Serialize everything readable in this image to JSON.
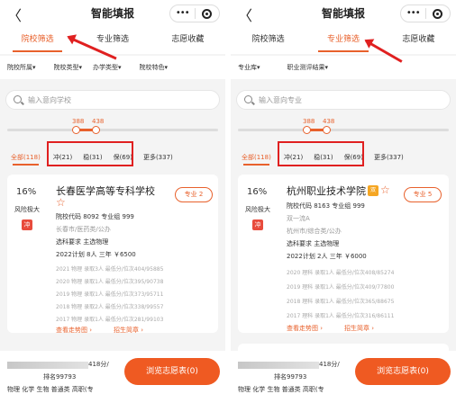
{
  "left": {
    "nav": {
      "title": "智能填报"
    },
    "tabs": [
      {
        "label": "院校筛选"
      },
      {
        "label": "专业筛选"
      },
      {
        "label": "志愿收藏"
      }
    ],
    "filters": [
      "院校所属▾",
      "院校类型▾",
      "办学类型▾",
      "院校特色▾"
    ],
    "search": {
      "placeholder": "输入意向学校"
    },
    "scores": {
      "low": "388",
      "high": "438"
    },
    "segments": {
      "all": "全部(118)",
      "chong": "冲(21)",
      "wen": "稳(31)",
      "bao": "保(69)",
      "more": "更多(337)"
    },
    "card": {
      "pct": "16%",
      "risk": "风险极大",
      "badge": "冲",
      "name": "长春医学高等专科学校",
      "major_btn": "专业 2",
      "code": "院校代码 8092  专业组 999",
      "location": "长春市/医药类/公办",
      "subject": "选科要求 主选物理",
      "plan": "2022计划 8人 三年 ￥6500",
      "history": [
        "2021 物理 录取3人 最低分/位次404/95885",
        "2020 物理 录取1人 最低分/位次395/90738",
        "2019 物理 录取1人 最低分/位次373/95711",
        "2018 物理 录取2人 最低分/位次338/99557",
        "2017 物理 录取1人 最低分/位次281/99103"
      ],
      "trend_link": "查看走势图 ›",
      "brochure_link": "招生简章 ›"
    },
    "bottom": {
      "rank_suffix": "418分/",
      "rank": "排名99793",
      "subjects": "物理 化学 生物 普通类 高职(专",
      "cta": "浏览志愿表(0)"
    }
  },
  "right": {
    "nav": {
      "title": "智能填报"
    },
    "tabs": [
      {
        "label": "院校筛选"
      },
      {
        "label": "专业筛选"
      },
      {
        "label": "志愿收藏"
      }
    ],
    "filters": [
      "专业库▾",
      "职业测评结果▾"
    ],
    "search": {
      "placeholder": "输入意向专业"
    },
    "scores": {
      "low": "388",
      "high": "438"
    },
    "segments": {
      "all": "全部(118)",
      "chong": "冲(21)",
      "wen": "稳(31)",
      "bao": "保(69)",
      "more": "更多(337)"
    },
    "card": {
      "pct": "16%",
      "risk": "风险极大",
      "badge": "冲",
      "name": "杭州职业技术学院",
      "tag": "双",
      "major_btn": "专业 5",
      "code": "院校代码 8163  专业组 999",
      "level": "双一流A",
      "location": "杭州市/综合类/公办",
      "subject": "选科要求 主选物理",
      "plan": "2022计划 2人 三年 ￥6000",
      "history": [
        "2020 理科 录取1人 最低分/位次408/85274",
        "2019 理科 录取1人 最低分/位次409/77800",
        "2018 理科 录取1人 最低分/位次365/88675",
        "2017 理科 录取1人 最低分/位次316/86111"
      ],
      "trend_link": "查看走势图 ›",
      "brochure_link": "招生简章 ›"
    },
    "bottom": {
      "rank_suffix": "418分/",
      "rank": "排名99793",
      "subjects": "物理 化学 生物 普通类 高职(专",
      "cta": "浏览志愿表(0)"
    }
  },
  "colors": {
    "accent": "#e8612c",
    "highlight": "#e02020",
    "cta": "#ef5a22"
  }
}
